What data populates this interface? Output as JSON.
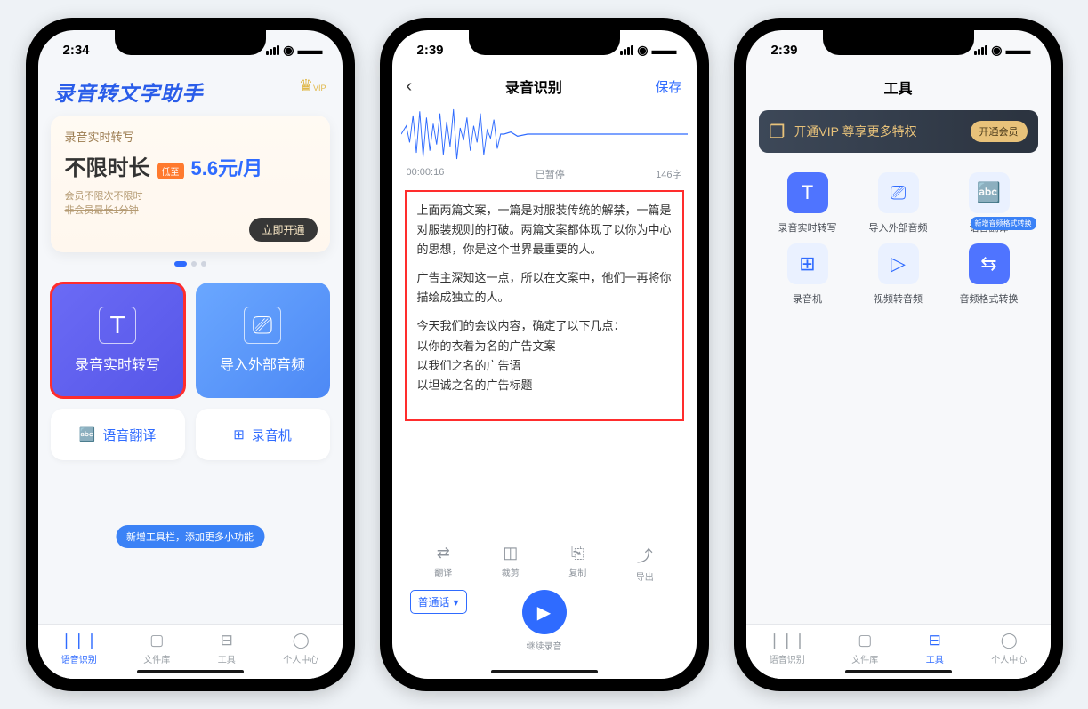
{
  "phone1": {
    "time": "2:34",
    "appTitle": "录音转文字助手",
    "promo": {
      "sub": "录音实时转写",
      "big": "不限时长",
      "badge": "低至",
      "price": "5.6元/月",
      "note1": "会员不限次不限时",
      "note2": "非会员最长1分钟",
      "btn": "立即开通"
    },
    "cards": {
      "realtime": "录音实时转写",
      "import": "导入外部音频",
      "translate": "语音翻译",
      "recorder": "录音机"
    },
    "pill": "新增工具栏，添加更多小功能",
    "tabs": {
      "t1": "语音识别",
      "t2": "文件库",
      "t3": "工具",
      "t4": "个人中心"
    }
  },
  "phone2": {
    "time": "2:39",
    "nav": {
      "title": "录音识别",
      "save": "保存"
    },
    "timebar": {
      "elapsed": "00:00:16",
      "status": "已暂停",
      "count": "146字"
    },
    "text": {
      "p1": "上面两篇文案，一篇是对服装传统的解禁，一篇是对服装规则的打破。两篇文案都体现了以你为中心的思想，你是这个世界最重要的人。",
      "p2": "广告主深知这一点，所以在文案中，他们一再将你描绘成独立的人。",
      "p3": "今天我们的会议内容，确定了以下几点：",
      "p4": "以你的衣着为名的广告文案",
      "p5": "以我们之名的广告语",
      "p6": "以坦诚之名的广告标题"
    },
    "tools": {
      "translate": "翻译",
      "crop": "裁剪",
      "copy": "复制",
      "export": "导出"
    },
    "lang": "普通话",
    "playLabel": "继续录音"
  },
  "phone3": {
    "time": "2:39",
    "title": "工具",
    "banner": {
      "text": "开通VIP 尊享更多特权",
      "btn": "开通会员"
    },
    "tools": {
      "t1": "录音实时转写",
      "t2": "导入外部音频",
      "t3": "语音翻译",
      "t4": "录音机",
      "t5": "视频转音频",
      "t6": "音频格式转换",
      "badge": "新增音频格式转换"
    },
    "tabs": {
      "t1": "语音识别",
      "t2": "文件库",
      "t3": "工具",
      "t4": "个人中心"
    }
  }
}
